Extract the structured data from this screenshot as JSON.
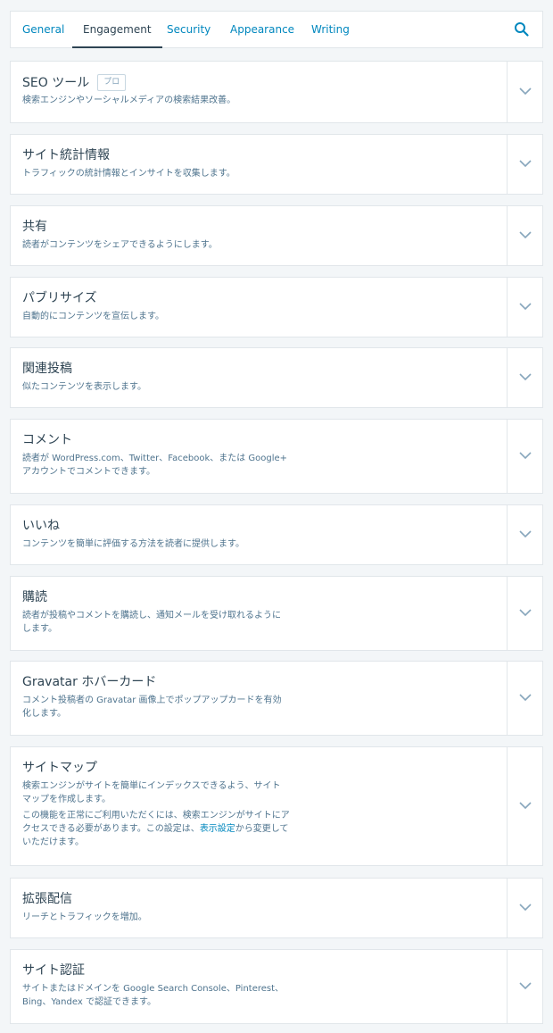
{
  "tabs": [
    "General",
    "Engagement",
    "Security",
    "Appearance",
    "Writing"
  ],
  "active_tab": "Engagement",
  "cards": [
    {
      "title": "SEO ツール",
      "badge": "プロ",
      "desc": "検索エンジンやソーシャルメディアの検索結果改善。"
    },
    {
      "title": "サイト統計情報",
      "desc": "トラフィックの統計情報とインサイトを収集します。"
    },
    {
      "title": "共有",
      "desc": "読者がコンテンツをシェアできるようにします。"
    },
    {
      "title": "パブリサイズ",
      "desc": "自動的にコンテンツを宣伝します。"
    },
    {
      "title": "関連投稿",
      "desc": "似たコンテンツを表示します。"
    },
    {
      "title": "コメント",
      "desc_lines": [
        "読者が WordPress.com、Twitter、Facebook、または Google+",
        "アカウントでコメントできます。"
      ]
    },
    {
      "title": "いいね",
      "desc": "コンテンツを簡単に評価する方法を読者に提供します。"
    },
    {
      "title": "購読",
      "desc_lines": [
        "読者が投稿やコメントを購読し、通知メールを受け取れるように",
        "します。"
      ]
    },
    {
      "title": "Gravatar ホバーカード",
      "desc_lines": [
        "コメント投稿者の Gravatar 画像上でポップアップカードを有効",
        "化します。"
      ]
    },
    {
      "title": "サイトマップ",
      "desc_lines": [
        "検索エンジンがサイトを簡単にインデックスできるよう、サイト",
        "マップを作成します。"
      ],
      "note_lines": [
        "この機能を正常にご利用いただくには、検索エンジンがサイトにア",
        "クセスできる必要があります。この設定は、"
      ],
      "note_link": "表示設定",
      "note_after": "から変更して",
      "note_last": "いただけます。"
    },
    {
      "title": "拡張配信",
      "desc": "リーチとトラフィックを増加。"
    },
    {
      "title": "サイト認証",
      "desc_lines": [
        "サイトまたはドメインを Google Search Console、Pinterest、",
        "Bing、Yandex で認証できます。"
      ]
    }
  ]
}
